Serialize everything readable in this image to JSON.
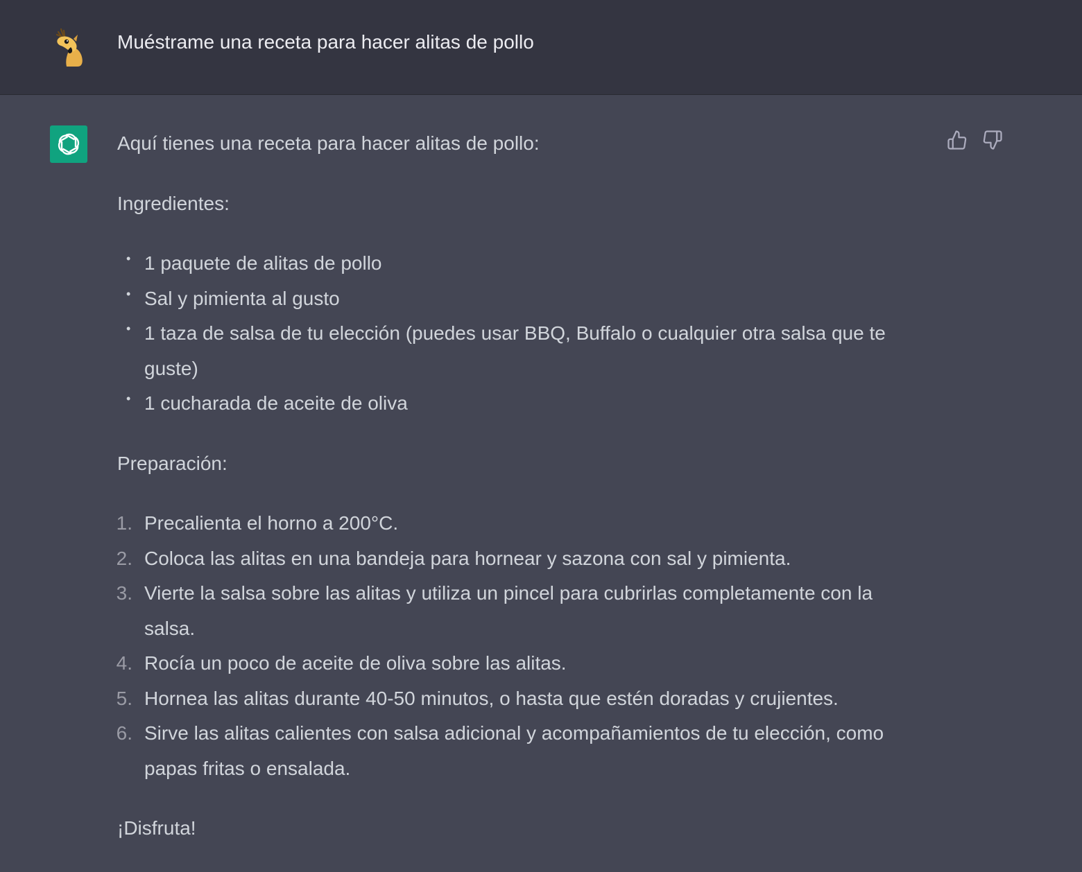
{
  "user_message": {
    "avatar": "user-avatar-camel-icon",
    "text": "Muéstrame una receta para hacer alitas de pollo"
  },
  "assistant_message": {
    "avatar": "openai-logo-icon",
    "intro": "Aquí tienes una receta para hacer alitas de pollo:",
    "ingredients_heading": "Ingredientes:",
    "ingredients": [
      {
        "bullet": "•",
        "lines": [
          "1 paquete de alitas de pollo"
        ]
      },
      {
        "bullet": "•",
        "lines": [
          "Sal y pimienta al gusto"
        ]
      },
      {
        "bullet": "•",
        "lines": [
          "1 taza de salsa de tu elección (puedes usar BBQ, Buffalo o cualquier otra salsa que te",
          "guste)"
        ]
      },
      {
        "bullet": "•",
        "lines": [
          "1 cucharada de aceite de oliva"
        ]
      }
    ],
    "preparation_heading": "Preparación:",
    "steps": [
      {
        "number": "1.",
        "lines": [
          "Precalienta el horno a 200°C."
        ]
      },
      {
        "number": "2.",
        "lines": [
          "Coloca las alitas en una bandeja para hornear y sazona con sal y pimienta."
        ]
      },
      {
        "number": "3.",
        "lines": [
          "Vierte la salsa sobre las alitas y utiliza un pincel para cubrirlas completamente con la",
          "salsa."
        ]
      },
      {
        "number": "4.",
        "lines": [
          "Rocía un poco de aceite de oliva sobre las alitas."
        ]
      },
      {
        "number": "5.",
        "lines": [
          "Hornea las alitas durante 40-50 minutos, o hasta que estén doradas y crujientes."
        ]
      },
      {
        "number": "6.",
        "lines": [
          "Sirve las alitas calientes con salsa adicional y acompañamientos de tu elección, como",
          "papas fritas o ensalada."
        ]
      }
    ],
    "closing": "¡Disfruta!"
  },
  "feedback": {
    "thumbs_up_icon": "thumbs-up-icon",
    "thumbs_down_icon": "thumbs-down-icon"
  },
  "colors": {
    "user_bg": "#343541",
    "assistant_bg": "#444654",
    "assistant_avatar_bg": "#10a37f",
    "text": "#d1d5db"
  }
}
